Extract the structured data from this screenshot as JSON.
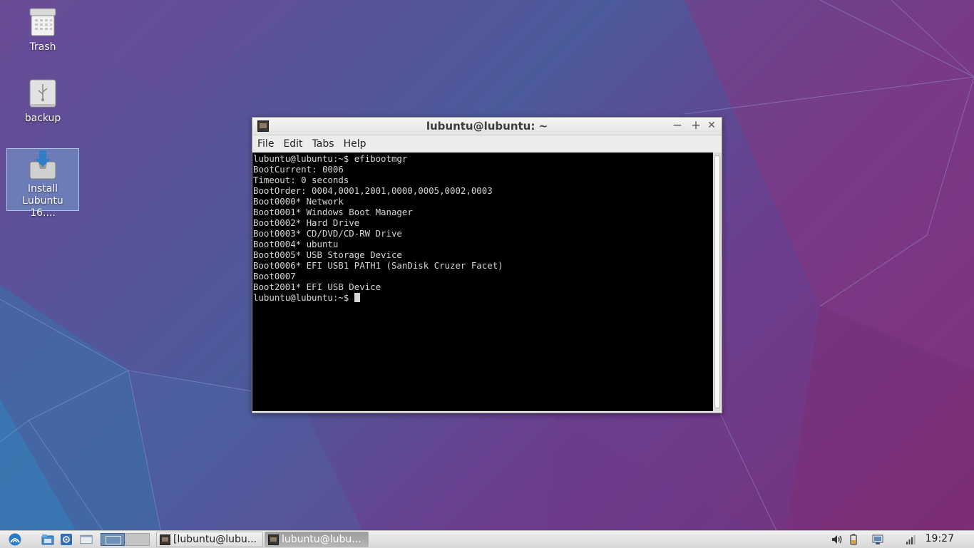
{
  "desktop": {
    "icons": [
      {
        "label": "Trash",
        "icon": "trash-icon"
      },
      {
        "label": "backup",
        "icon": "usb-drive-icon"
      },
      {
        "label": "Install Lubuntu 16....",
        "icon": "install-download-icon"
      }
    ]
  },
  "terminal": {
    "title": "lubuntu@lubuntu: ~",
    "controls": {
      "minimize": "−",
      "maximize": "+",
      "close": "✕"
    },
    "menu": [
      "File",
      "Edit",
      "Tabs",
      "Help"
    ],
    "lines": [
      "lubuntu@lubuntu:~$ efibootmgr",
      "BootCurrent: 0006",
      "Timeout: 0 seconds",
      "BootOrder: 0004,0001,2001,0000,0005,0002,0003",
      "Boot0000* Network",
      "Boot0001* Windows Boot Manager",
      "Boot0002* Hard Drive",
      "Boot0003* CD/DVD/CD-RW Drive",
      "Boot0004* ubuntu",
      "Boot0005* USB Storage Device",
      "Boot0006* EFI USB1 PATH1 (SanDisk Cruzer Facet)",
      "Boot0007",
      "Boot2001* EFI USB Device"
    ],
    "prompt": "lubuntu@lubuntu:~$ "
  },
  "taskbar": {
    "launchers": [
      "start-menu-icon",
      "file-manager-icon",
      "control-center-icon",
      "show-desktop-icon",
      "workspace-1-icon",
      "workspace-2-icon"
    ],
    "tasks": [
      {
        "label": "[lubuntu@lubu...",
        "active": false
      },
      {
        "label": "lubuntu@lubu...",
        "active": true
      }
    ],
    "tray": [
      "volume-icon",
      "battery-icon",
      "network-icon",
      "signal-icon"
    ],
    "clock": "19:27"
  },
  "colors": {
    "terminal_bg": "#000000",
    "terminal_fg": "#d6d6d6",
    "desktop_primary": "#6a4a96",
    "desktop_accent": "#7a2f78"
  }
}
